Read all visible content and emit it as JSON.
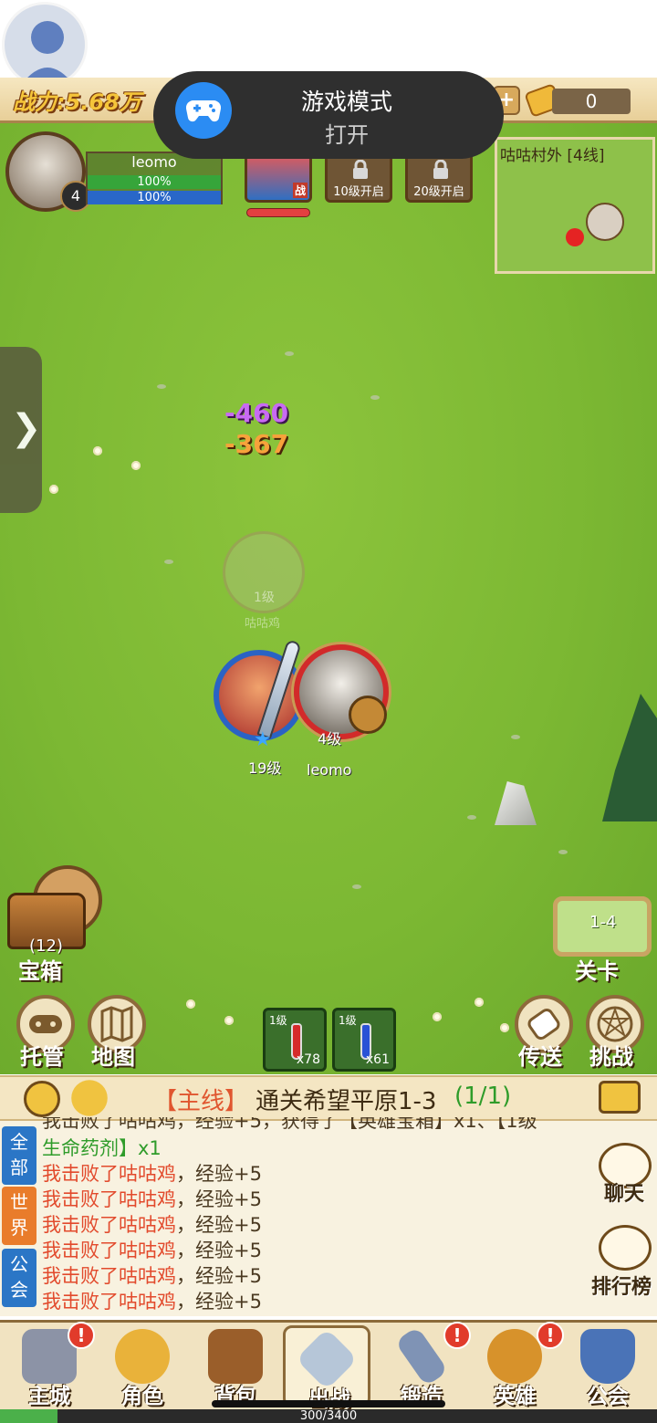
{
  "toast": {
    "title": "游戏模式",
    "subtitle": "打开",
    "icon": "gamepad-icon",
    "color": "#2b8cf3"
  },
  "topbar": {
    "power": "战力:5.68万",
    "tickets": "0"
  },
  "player": {
    "name": "leomo",
    "level": "4",
    "hp_percent": "100%",
    "mp_percent": "100%"
  },
  "hero_slots": {
    "active_tag": "战",
    "locked_1": "10级开启",
    "locked_2": "20级开启"
  },
  "minimap": {
    "title": "咕咕村外 [4线]"
  },
  "battle": {
    "damage_1": "-460",
    "damage_2": "-367",
    "ghost_level": "1级",
    "ghost_name": "咕咕鸡",
    "hero_level": "19级",
    "my_level": "4级",
    "my_name": "leomo"
  },
  "treasure": {
    "count": "(12)",
    "label": "宝箱"
  },
  "stage": {
    "number": "1-4",
    "label": "关卡"
  },
  "buttons": {
    "auto": "托管",
    "map": "地图",
    "teleport": "传送",
    "challenge": "挑战"
  },
  "potions": [
    {
      "level": "1级",
      "qty": "x78",
      "color": "#d62a2a"
    },
    {
      "level": "1级",
      "qty": "x61",
      "color": "#2a52d6"
    }
  ],
  "quest": {
    "tag": "【主线】",
    "text": "通关希望平原1-3",
    "progress": "(1/1)"
  },
  "chat": {
    "tabs": [
      "全部",
      "世界",
      "公会"
    ],
    "partial_line": "我击败了咕咕鸡，经验+5，获得了【英雄宝箱】x1、【1级",
    "reward_line": "生命药剂】x1",
    "lines": [
      {
        "me": "我击败了",
        "mob": "咕咕鸡",
        "rest": "，经验+5"
      },
      {
        "me": "我击败了",
        "mob": "咕咕鸡",
        "rest": "，经验+5"
      },
      {
        "me": "我击败了",
        "mob": "咕咕鸡",
        "rest": "，经验+5"
      },
      {
        "me": "我击败了",
        "mob": "咕咕鸡",
        "rest": "，经验+5"
      },
      {
        "me": "我击败了",
        "mob": "咕咕鸡",
        "rest": "，经验+5"
      },
      {
        "me": "我击败了",
        "mob": "咕咕鸡",
        "rest": "，经验+5"
      }
    ],
    "chat_btn": "聊天",
    "rank_btn": "排行榜"
  },
  "nav": [
    {
      "label": "主城",
      "icon": "castle-icon",
      "badge": "!"
    },
    {
      "label": "角色",
      "icon": "crown-icon",
      "badge": ""
    },
    {
      "label": "背包",
      "icon": "backpack-icon",
      "badge": ""
    },
    {
      "label": "出战",
      "icon": "crossed-swords-icon",
      "badge": ""
    },
    {
      "label": "锻造",
      "icon": "hammer-icon",
      "badge": "!"
    },
    {
      "label": "英雄",
      "icon": "fist-badge-icon",
      "badge": "!"
    },
    {
      "label": "公会",
      "icon": "guild-shield-icon",
      "badge": ""
    }
  ],
  "exp": {
    "text": "300/3400",
    "fraction": 0.088
  }
}
